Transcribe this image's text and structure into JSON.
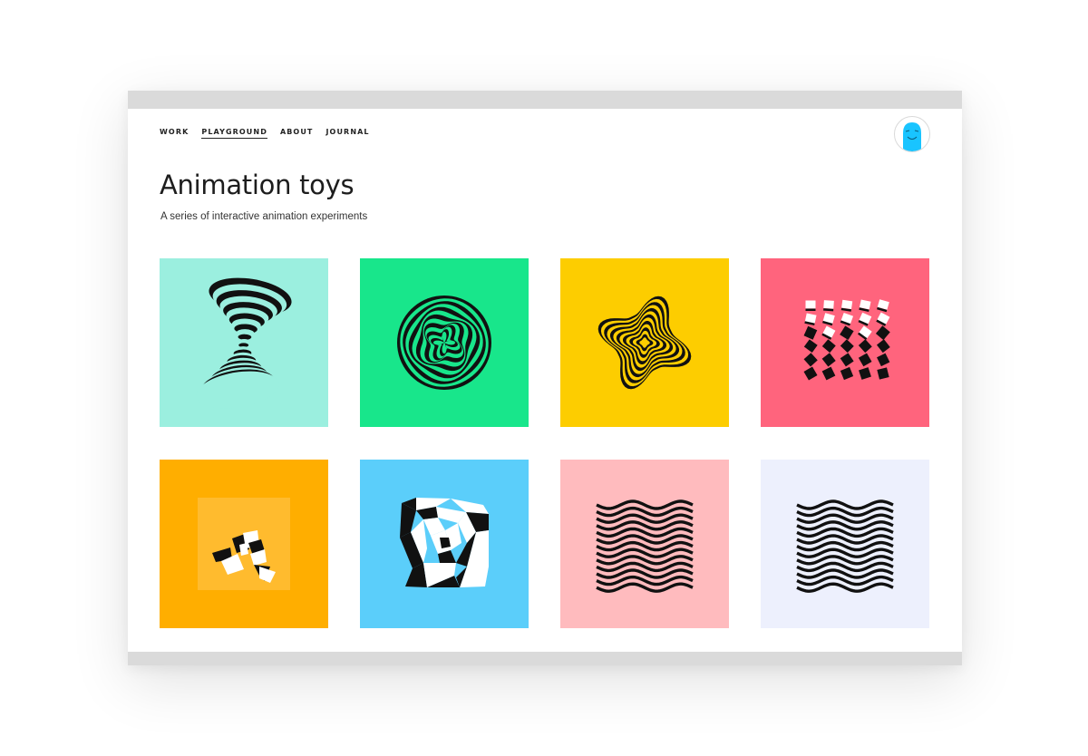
{
  "nav": {
    "items": [
      {
        "label": "WORK",
        "active": false
      },
      {
        "label": "PLAYGROUND",
        "active": true
      },
      {
        "label": "ABOUT",
        "active": false
      },
      {
        "label": "JOURNAL",
        "active": false
      }
    ]
  },
  "header": {
    "title": "Animation toys",
    "subtitle": "A series of interactive animation experiments"
  },
  "avatar": {
    "icon": "avatar-face-icon",
    "color": "#19c4ff"
  },
  "tiles": [
    {
      "color": "#9befdf",
      "icon": "hourglass-rings-icon"
    },
    {
      "color": "#18e68b",
      "icon": "wavy-circle-rings-icon"
    },
    {
      "color": "#fdcd00",
      "icon": "star-rings-icon"
    },
    {
      "color": "#ff647d",
      "icon": "flipping-squares-grid-icon"
    },
    {
      "color": "#ffae00",
      "icon": "shattered-squares-icon"
    },
    {
      "color": "#5bcefa",
      "icon": "geometric-spiral-icon"
    },
    {
      "color": "#ffbbbe",
      "icon": "wave-lines-icon"
    },
    {
      "color": "#edf0fd",
      "icon": "wave-lines-icon"
    }
  ]
}
